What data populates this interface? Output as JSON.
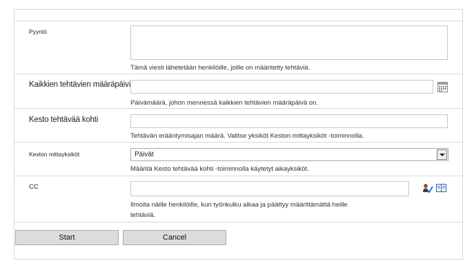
{
  "form": {
    "request": {
      "label": "Pyyntö",
      "value": "",
      "description": "Tämä viesti lähetetään henkilöille, joille on määritetty tehtäviä."
    },
    "due_date": {
      "label": "Kaikkien tehtävien määräpäivä",
      "value": "",
      "description": "Päivämäärä, johon mennessä kaikkien tehtävien määräpäivä on."
    },
    "duration": {
      "label": "Kesto tehtävää kohti",
      "value": "",
      "description": "Tehtävän erääntymisajan määrä. Valitse yksiköt Keston mittayksiköt -toiminnolla."
    },
    "duration_units": {
      "label": "Keston mittayksiköt",
      "selected": "Päivät",
      "description": "Määritä Kesto tehtävää kohti -toiminnolla käytetyt aikayksiköt."
    },
    "cc": {
      "label": "CC",
      "value": "",
      "description_line1": "Ilmoita näille henkilöille, kun työnkulku alkaa ja päättyy määrittämättä heille",
      "description_line2": "tehtäviä."
    }
  },
  "buttons": {
    "start": "Start",
    "cancel": "Cancel"
  },
  "icons": {
    "calendar": "calendar-icon",
    "check_names": "check-names-icon",
    "address_book": "address-book-icon"
  }
}
